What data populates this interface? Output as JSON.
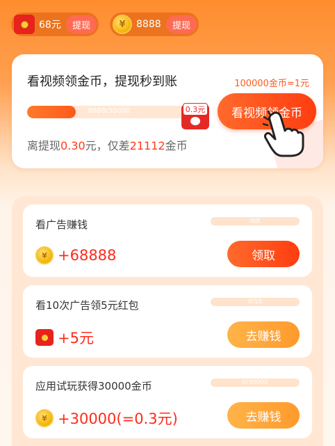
{
  "topbar": {
    "cash": {
      "amount": "68元",
      "button": "提现"
    },
    "coins": {
      "amount": "8888",
      "button": "提现",
      "coin_glyph": "¥"
    }
  },
  "main_card": {
    "title": "看视频领金币，提现秒到账",
    "rate": "100000金币=1元",
    "progress_text": "8888/30000",
    "progress_fraction": 0.296,
    "target_label": "0.3元",
    "gap_prefix": "离提现",
    "gap_amount": "0.30",
    "gap_mid": "元，仅差",
    "gap_coins": "21112",
    "gap_suffix": "金币",
    "watch_button": "看视频领金币"
  },
  "tasks": [
    {
      "name": "看广告赚钱",
      "progress": "0/8",
      "reward": "+68888",
      "reward_icon": "coin-icon",
      "action": "领取",
      "action_style": "primary"
    },
    {
      "name": "看10次广告领5元红包",
      "progress": "0/10",
      "reward": "+5元",
      "reward_icon": "red-packet-icon",
      "action": "去赚钱",
      "action_style": "secondary"
    },
    {
      "name": "应用试玩获得30000金币",
      "progress": "0/30000",
      "reward": "+30000(=0.3元)",
      "reward_icon": "coin-icon",
      "action": "去赚钱",
      "action_style": "secondary"
    }
  ],
  "colors": {
    "accent": "#ff5a1a",
    "reward_red": "#ff2a1a",
    "secondary_button": "#ffa63a"
  }
}
